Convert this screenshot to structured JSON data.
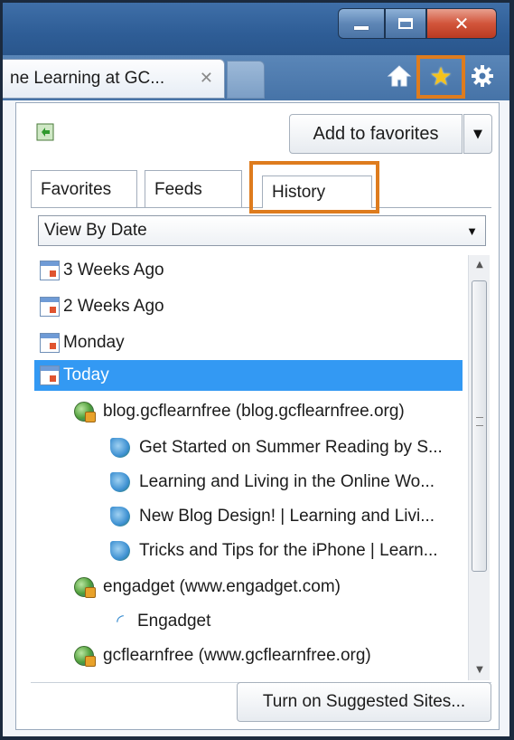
{
  "window": {
    "minimize_label": "",
    "close_label": "✕"
  },
  "browser_tab": {
    "title": "ne Learning at GC...",
    "close_label": "✕"
  },
  "toolbar": {
    "star_glyph": "★"
  },
  "favorites_center": {
    "add_to_favorites_label": "Add to favorites",
    "add_dropdown_glyph": "▼",
    "tabs": [
      {
        "label": "Favorites"
      },
      {
        "label": "Feeds"
      },
      {
        "label": "History",
        "selected": true
      }
    ],
    "view_select": {
      "value": "View By Date",
      "arrow": "▼"
    },
    "history_items": [
      {
        "label": "3 Weeks Ago",
        "icon": "calendar-icon",
        "level": 0
      },
      {
        "label": "2 Weeks Ago",
        "icon": "calendar-icon",
        "level": 0
      },
      {
        "label": "Monday",
        "icon": "calendar-icon",
        "level": 0
      },
      {
        "label": "Today",
        "icon": "calendar-icon",
        "level": 0,
        "selected": true
      },
      {
        "label": "blog.gcflearnfree (blog.gcflearnfree.org)",
        "icon": "site-globe-icon",
        "level": 1
      },
      {
        "label": "Get Started on Summer Reading by S...",
        "icon": "webpage-icon",
        "level": 2
      },
      {
        "label": "Learning and Living in the Online Wo...",
        "icon": "webpage-icon",
        "level": 2
      },
      {
        "label": "New Blog Design! | Learning and Livi...",
        "icon": "webpage-icon",
        "level": 2
      },
      {
        "label": "Tricks and Tips for the iPhone | Learn...",
        "icon": "webpage-icon",
        "level": 2
      },
      {
        "label": "engadget (www.engadget.com)",
        "icon": "site-globe-icon",
        "level": 1
      },
      {
        "label": "Engadget",
        "icon": "feed-icon",
        "level": 2
      },
      {
        "label": "gcflearnfree (www.gcflearnfree.org)",
        "icon": "site-globe-icon",
        "level": 1
      }
    ],
    "scroll_up": "▲",
    "scroll_down": "▼",
    "suggested_sites_label": "Turn on Suggested Sites..."
  },
  "colors": {
    "highlight_outline": "#de7c1e",
    "selection": "#3399f3",
    "titlebar": "#2e5d96"
  }
}
